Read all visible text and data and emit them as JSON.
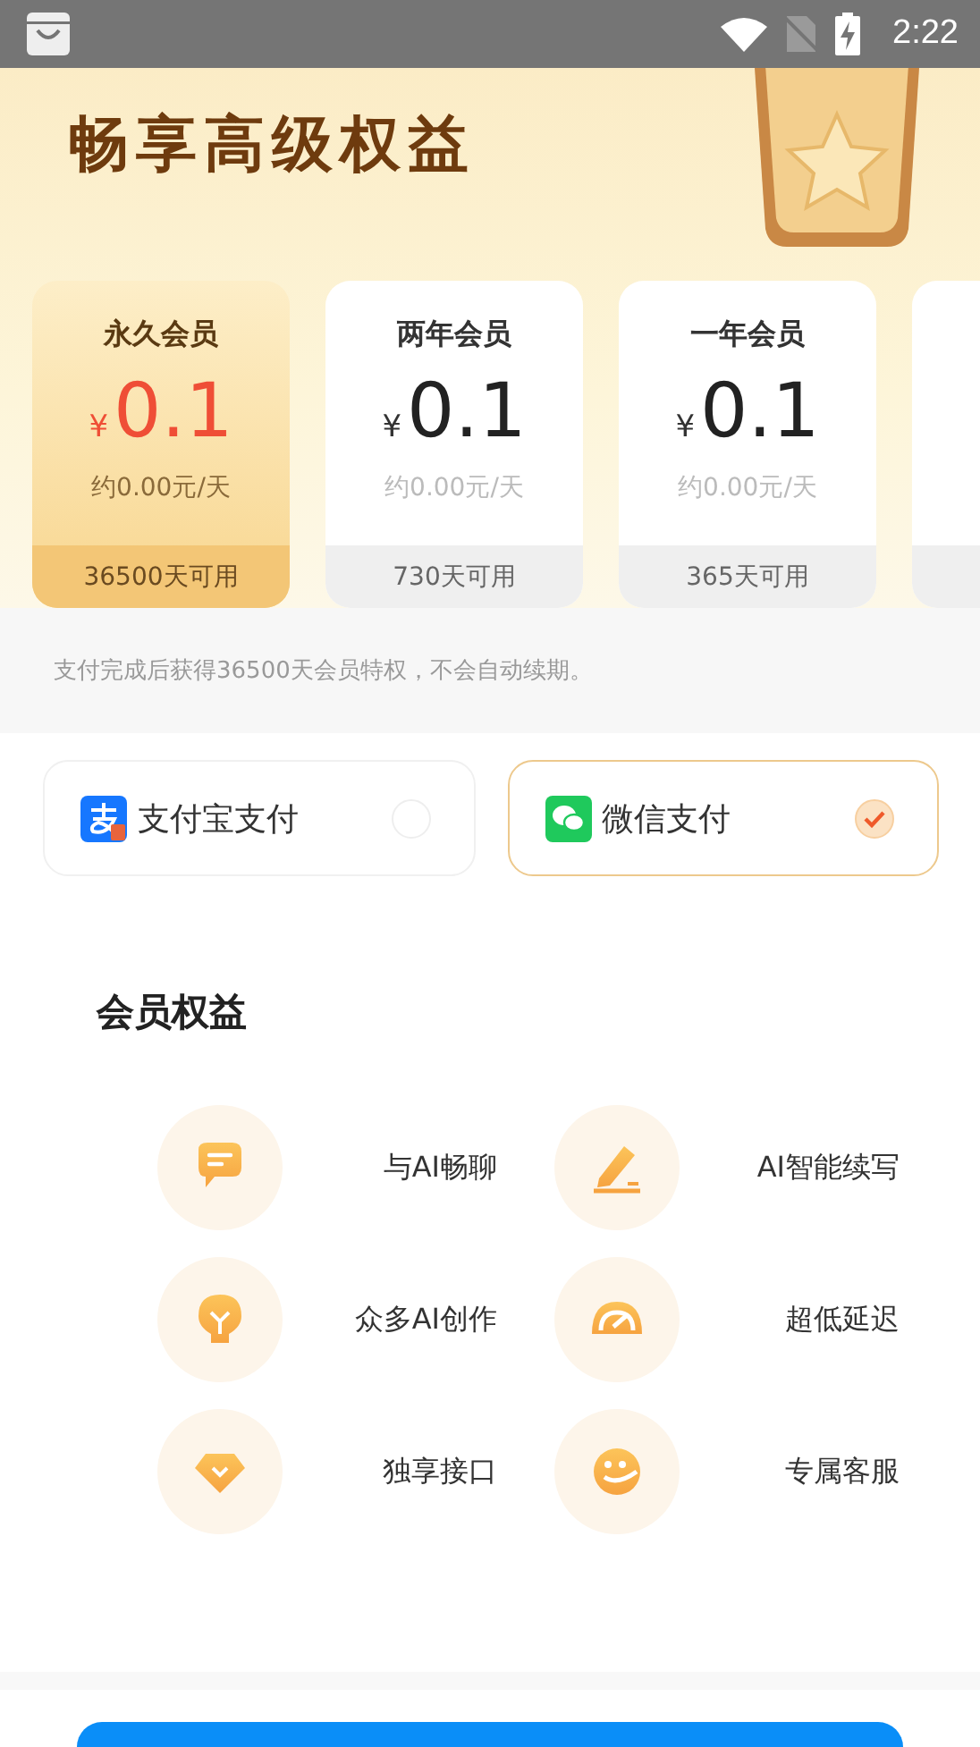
{
  "status_bar": {
    "time": "2:22"
  },
  "banner": {
    "title": "畅享高级权益"
  },
  "plans": [
    {
      "name": "永久会员",
      "currency": "¥",
      "price": "0.1",
      "per_day": "约0.00元/天",
      "duration": "36500天可用",
      "selected": true
    },
    {
      "name": "两年会员",
      "currency": "¥",
      "price": "0.1",
      "per_day": "约0.00元/天",
      "duration": "730天可用",
      "selected": false
    },
    {
      "name": "一年会员",
      "currency": "¥",
      "price": "0.1",
      "per_day": "约0.00元/天",
      "duration": "365天可用",
      "selected": false
    }
  ],
  "note": "支付完成后获得36500天会员特权，不会自动续期。",
  "payment_methods": [
    {
      "label": "支付宝支付",
      "kind": "alipay",
      "selected": false
    },
    {
      "label": "微信支付",
      "kind": "wechat",
      "selected": true
    }
  ],
  "benefits": {
    "title": "会员权益",
    "items": [
      {
        "label": "与AI畅聊",
        "kind": "chat"
      },
      {
        "label": "AI智能续写",
        "kind": "pen"
      },
      {
        "label": "众多AI创作",
        "kind": "bulb"
      },
      {
        "label": "超低延迟",
        "kind": "gauge"
      },
      {
        "label": "独享接口",
        "kind": "diamond"
      },
      {
        "label": "专属客服",
        "kind": "smile"
      }
    ]
  }
}
